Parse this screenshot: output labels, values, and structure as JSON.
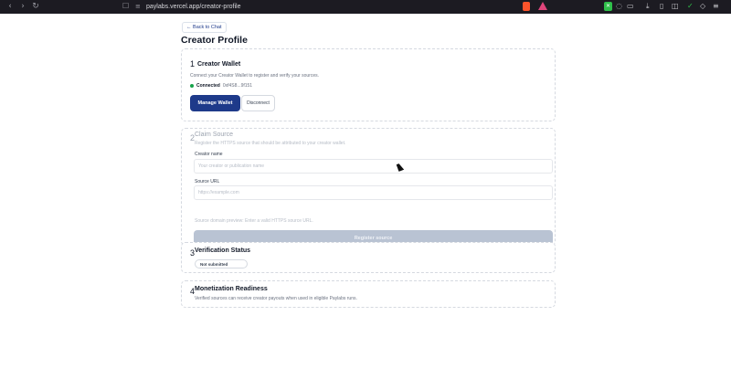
{
  "browser": {
    "url": "paylabs.vercel.app/creator-profile",
    "nav_back": "‹",
    "nav_forward": "›",
    "nav_reload": "↻"
  },
  "page": {
    "back_link": "← Back to Chat",
    "title": "Creator Profile"
  },
  "wallet": {
    "step": "1",
    "title": "Creator Wallet",
    "description": "Connect your Creator Wallet to register and verify your sources.",
    "status": "Connected",
    "address": "0xf4S8...9f151",
    "manage_label": "Manage Wallet",
    "disconnect_label": "Disconnect",
    "status_color": "#16a34a",
    "accent": "#1e3a8a"
  },
  "claim": {
    "step": "2",
    "title": "Claim Source",
    "description": "Register the HTTPS source that should be attributed to your creator wallet.",
    "creator_name_label": "Creator name",
    "creator_name_placeholder": "Your creator or publication name",
    "source_url_label": "Source URL",
    "source_url_placeholder": "https://example.com",
    "hint": "Source domain preview: Enter a valid HTTPS source URL.",
    "register_label": "Register source"
  },
  "verification": {
    "step": "3",
    "title": "Verification Status",
    "status": "Not submitted"
  },
  "monetization": {
    "step": "4",
    "title": "Monetization Readiness",
    "description": "Verified sources can receive creator payouts when used in eligible Paylabs runs."
  }
}
